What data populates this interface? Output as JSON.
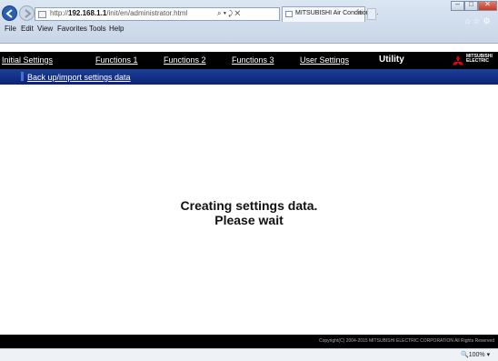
{
  "browser": {
    "address": {
      "prefix": "http://",
      "host": "192.168.1.1",
      "path": "/init/en/administrator.html",
      "tools": "⌕ ▾ ⤸ ✕"
    },
    "tab": {
      "label": "MITSUBISHI Air Conditione...",
      "close": "✕"
    },
    "window_controls": {
      "minimize": "–",
      "maximize": "□",
      "close": "✕"
    },
    "toolbar_icons": "⌂☆⚙",
    "menu": [
      "File",
      "Edit",
      "View",
      "Favorites",
      "Tools",
      "Help"
    ],
    "zoom": "🔍100%  ▾"
  },
  "app": {
    "tabs": [
      {
        "label": "Initial Settings"
      },
      {
        "label": "Functions 1"
      },
      {
        "label": "Functions 2"
      },
      {
        "label": "Functions 3"
      },
      {
        "label": "User Settings"
      },
      {
        "label": "Utility"
      }
    ],
    "logo": {
      "line1": "MITSUBISHI",
      "line2": "ELECTRIC"
    },
    "sub_nav": {
      "link": "Back up/import settings data"
    },
    "message": {
      "line1": "Creating settings data.",
      "line2": "Please wait"
    },
    "footer": {
      "copyright": "Copyright(C) 2004-2015 MITSUBISHI ELECTRIC CORPORATION All Rights Reserved"
    }
  },
  "colors": {
    "header_bg": "#000000",
    "subbar_bg": "#0c2375",
    "logo_red": "#e60012"
  }
}
